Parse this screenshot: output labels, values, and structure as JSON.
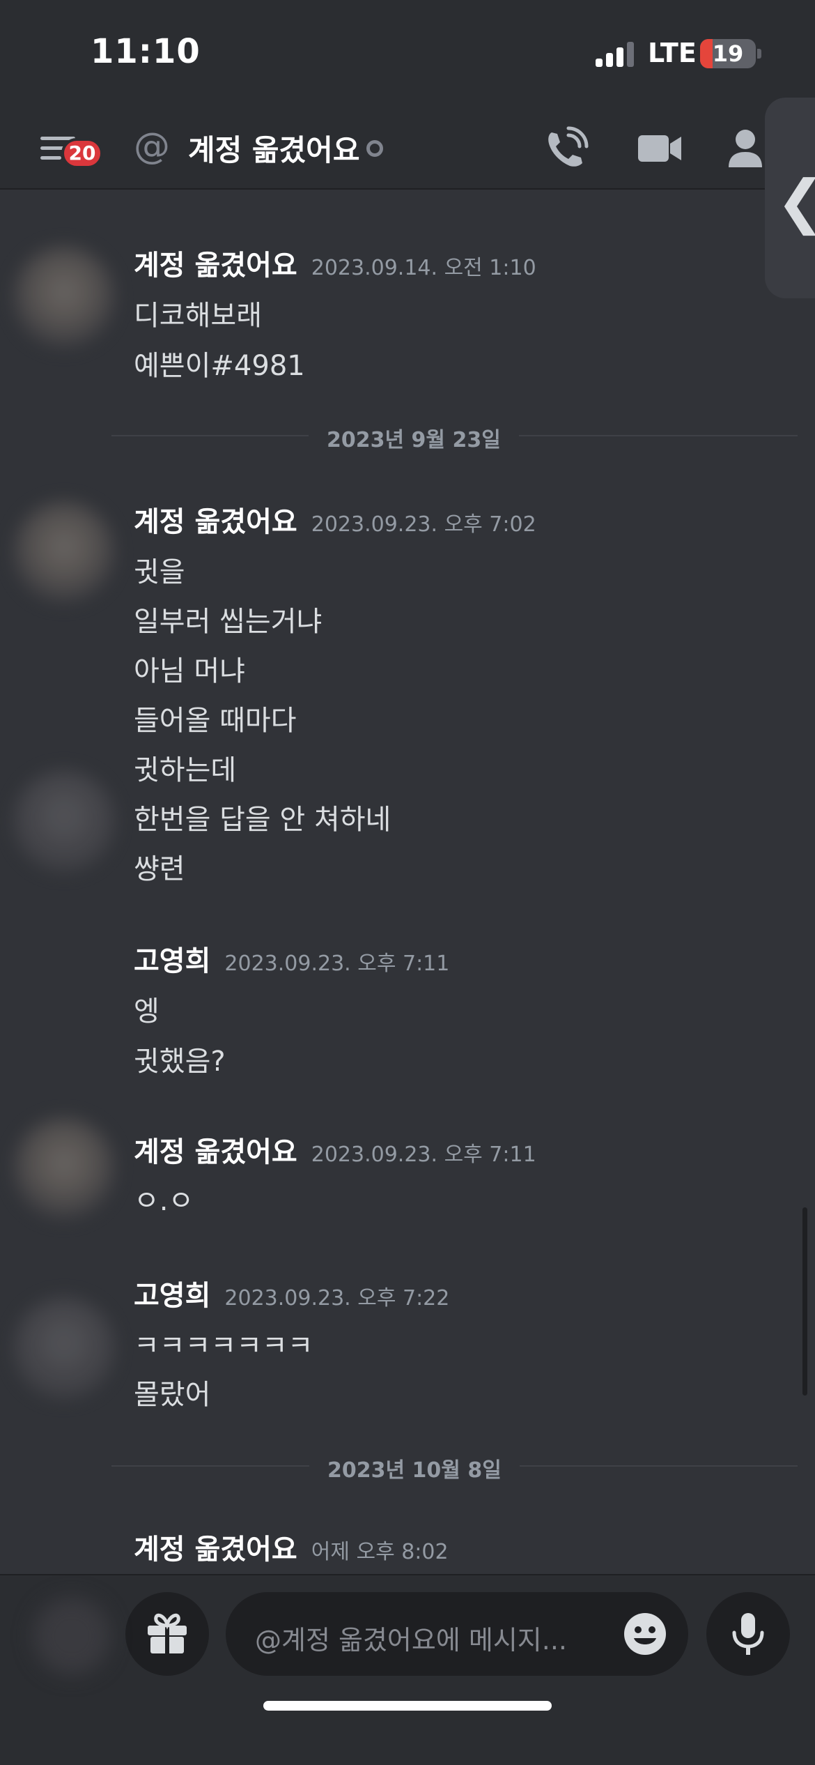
{
  "status_bar": {
    "time": "11:10",
    "network": "LTE",
    "battery": "19"
  },
  "header": {
    "menu_badge": "20",
    "at_symbol": "@",
    "title": "계정 옮겼어요",
    "icons": [
      "voice-call-icon",
      "video-call-icon",
      "member-list-icon"
    ]
  },
  "side_tab": {
    "chevron": "❮"
  },
  "messages": {
    "g1": {
      "author": "계정 옮겼어요",
      "time": "2023.09.14. 오전 1:10",
      "lines": [
        "디코해보래",
        "예쁜이#4981"
      ]
    },
    "divider1": "2023년 9월 23일",
    "g2": {
      "author": "계정 옮겼어요",
      "time": "2023.09.23. 오후 7:02",
      "lines": [
        "귓을",
        "일부러 씹는거냐",
        "아님 머냐",
        "들어올 때마다",
        "귓하는데",
        "한번을 답을 안 쳐하네",
        "썅련"
      ]
    },
    "g3": {
      "author": "고영희",
      "time": "2023.09.23. 오후 7:11",
      "lines": [
        "엥",
        "귓했음?"
      ]
    },
    "g4": {
      "author": "계정 옮겼어요",
      "time": "2023.09.23. 오후 7:11",
      "lines": [
        "ㅇ.ㅇ"
      ]
    },
    "g5": {
      "author": "고영희",
      "time": "2023.09.23. 오후 7:22",
      "lines": [
        "ㅋㅋㅋㅋㅋㅋㅋ",
        "몰랐어"
      ]
    },
    "divider2": "2023년 10월 8일",
    "g6": {
      "author": "계정 옮겼어요",
      "time": "어제 오후 8:02"
    }
  },
  "input": {
    "placeholder": "@계정 옮겼어요에 메시지...",
    "gift_icon": "gift-icon",
    "emoji_icon": "emoji-icon",
    "mic_icon": "microphone-icon"
  },
  "colors": {
    "background": "#313338",
    "header": "#2b2d31",
    "badge": "#da373c",
    "text": "#dbdee1",
    "muted": "#949ba4"
  }
}
